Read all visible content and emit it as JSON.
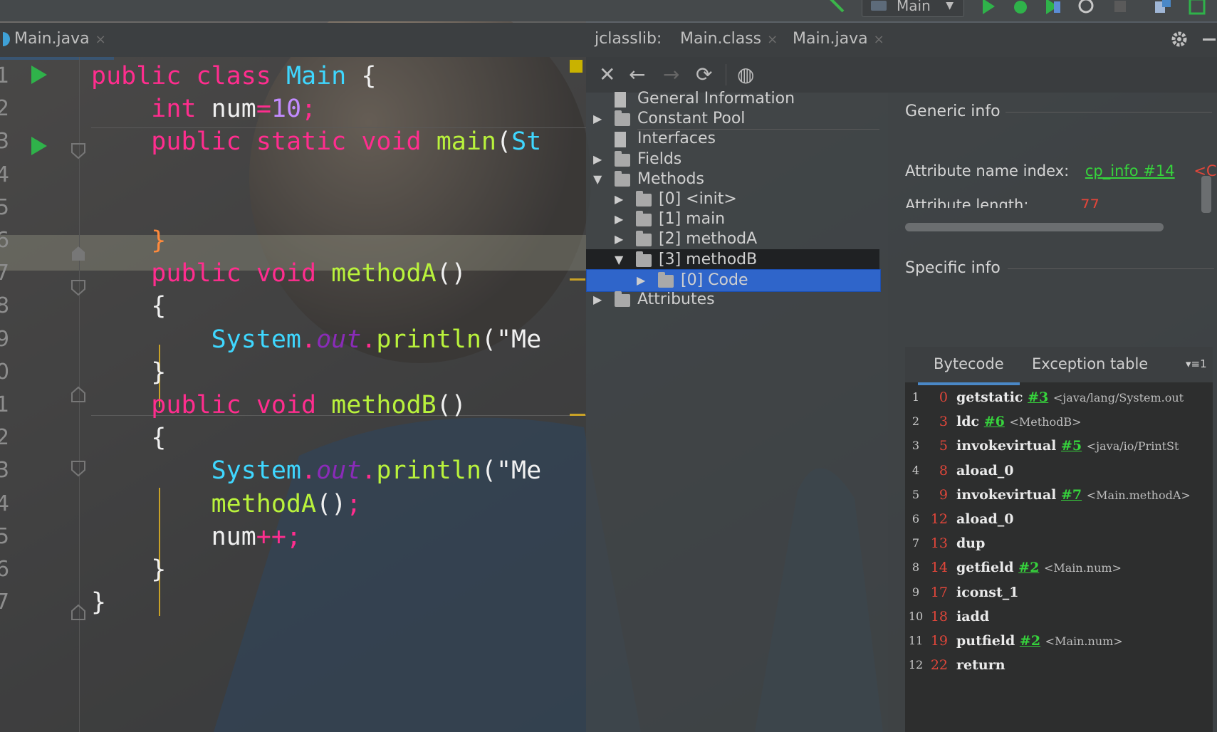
{
  "toolbar": {
    "run_config": "Main"
  },
  "editor": {
    "tab": {
      "label": "Main.java",
      "close": "×"
    },
    "lines": [
      {
        "n": "1",
        "tokens": [
          [
            "kw",
            "public "
          ],
          [
            "kw",
            "class "
          ],
          [
            "cls",
            "Main "
          ],
          [
            "plain",
            "{"
          ]
        ]
      },
      {
        "n": "2",
        "tokens": [
          [
            "plain",
            "    "
          ],
          [
            "kw",
            "int "
          ],
          [
            "plain",
            "num"
          ],
          [
            "kw",
            "="
          ],
          [
            "num",
            "10"
          ],
          [
            "kw",
            ";"
          ]
        ]
      },
      {
        "n": "3",
        "tokens": [
          [
            "plain",
            "    "
          ],
          [
            "kw",
            "public "
          ],
          [
            "kw",
            "static "
          ],
          [
            "kw",
            "void "
          ],
          [
            "fn",
            "main"
          ],
          [
            "plain",
            "("
          ],
          [
            "cls",
            "St"
          ]
        ]
      },
      {
        "n": "4",
        "tokens": []
      },
      {
        "n": "5",
        "tokens": []
      },
      {
        "n": "6",
        "tokens": [
          [
            "plain",
            "    "
          ],
          [
            "orange",
            "}"
          ]
        ]
      },
      {
        "n": "7",
        "tokens": [
          [
            "plain",
            "    "
          ],
          [
            "kw",
            "public "
          ],
          [
            "kw",
            "void "
          ],
          [
            "fn",
            "methodA"
          ],
          [
            "plain",
            "()"
          ]
        ]
      },
      {
        "n": "8",
        "tokens": [
          [
            "plain",
            "    {"
          ]
        ]
      },
      {
        "n": "9",
        "tokens": [
          [
            "plain",
            "        "
          ],
          [
            "cls",
            "System"
          ],
          [
            "kw",
            "."
          ],
          [
            "italic",
            "out"
          ],
          [
            "kw",
            "."
          ],
          [
            "fn",
            "println"
          ],
          [
            "plain",
            "(\"Me"
          ]
        ]
      },
      {
        "n": "0",
        "tokens": [
          [
            "plain",
            "    }"
          ]
        ]
      },
      {
        "n": "1",
        "tokens": [
          [
            "plain",
            "    "
          ],
          [
            "kw",
            "public "
          ],
          [
            "kw",
            "void "
          ],
          [
            "fn",
            "methodB"
          ],
          [
            "plain",
            "()"
          ]
        ]
      },
      {
        "n": "2",
        "tokens": [
          [
            "plain",
            "    {"
          ]
        ]
      },
      {
        "n": "3",
        "tokens": [
          [
            "plain",
            "        "
          ],
          [
            "cls",
            "System"
          ],
          [
            "kw",
            "."
          ],
          [
            "italic",
            "out"
          ],
          [
            "kw",
            "."
          ],
          [
            "fn",
            "println"
          ],
          [
            "plain",
            "(\"Me"
          ]
        ]
      },
      {
        "n": "4",
        "tokens": [
          [
            "plain",
            "        "
          ],
          [
            "fn",
            "methodA"
          ],
          [
            "plain",
            "()"
          ],
          [
            "kw",
            ";"
          ]
        ]
      },
      {
        "n": "5",
        "tokens": [
          [
            "plain",
            "        num"
          ],
          [
            "kw",
            "++;"
          ]
        ]
      },
      {
        "n": "6",
        "tokens": [
          [
            "plain",
            "    }"
          ]
        ]
      },
      {
        "n": "7",
        "tokens": [
          [
            "plain",
            "}"
          ]
        ]
      }
    ]
  },
  "right_tabs": {
    "tool_label": "jclasslib:",
    "tab1": {
      "label": "Main.class",
      "close": "×"
    },
    "tab2": {
      "label": "Main.java",
      "close": "×"
    }
  },
  "tree": {
    "items": [
      {
        "label": "General Information",
        "depth": 0,
        "arrow": "",
        "kind": "file"
      },
      {
        "label": "Constant Pool",
        "depth": 0,
        "arrow": "▶",
        "kind": "folder"
      },
      {
        "label": "Interfaces",
        "depth": 0,
        "arrow": "",
        "kind": "file"
      },
      {
        "label": "Fields",
        "depth": 0,
        "arrow": "▶",
        "kind": "folder"
      },
      {
        "label": "Methods",
        "depth": 0,
        "arrow": "▼",
        "kind": "folder"
      },
      {
        "label": "[0] <init>",
        "depth": 1,
        "arrow": "▶",
        "kind": "folder"
      },
      {
        "label": "[1] main",
        "depth": 1,
        "arrow": "▶",
        "kind": "folder"
      },
      {
        "label": "[2] methodA",
        "depth": 1,
        "arrow": "▶",
        "kind": "folder"
      },
      {
        "label": "[3] methodB",
        "depth": 1,
        "arrow": "▼",
        "kind": "folder",
        "state": "dark"
      },
      {
        "label": "[0] Code",
        "depth": 2,
        "arrow": "▶",
        "kind": "folder",
        "state": "selected"
      },
      {
        "label": "Attributes",
        "depth": 0,
        "arrow": "▶",
        "kind": "folder"
      }
    ]
  },
  "details": {
    "generic_title": "Generic info",
    "attr_name_label": "Attribute name index:",
    "attr_name_link": "cp_info #14",
    "attr_name_value": "<C",
    "attr_length_label": "Attribute length:",
    "attr_length_value": "77",
    "specific_title": "Specific info",
    "tabs": {
      "bytecode": "Bytecode",
      "exception": "Exception table",
      "menu": "▾≡1"
    },
    "bytecode": [
      {
        "n": "1",
        "off": "0",
        "op": "getstatic",
        "ref": "#3",
        "cmt": "<java/lang/System.out"
      },
      {
        "n": "2",
        "off": "3",
        "op": "ldc",
        "ref": "#6",
        "cmt": "<MethodB>"
      },
      {
        "n": "3",
        "off": "5",
        "op": "invokevirtual",
        "ref": "#5",
        "cmt": "<java/io/PrintSt"
      },
      {
        "n": "4",
        "off": "8",
        "op": "aload_0",
        "ref": "",
        "cmt": ""
      },
      {
        "n": "5",
        "off": "9",
        "op": "invokevirtual",
        "ref": "#7",
        "cmt": "<Main.methodA>"
      },
      {
        "n": "6",
        "off": "12",
        "op": "aload_0",
        "ref": "",
        "cmt": ""
      },
      {
        "n": "7",
        "off": "13",
        "op": "dup",
        "ref": "",
        "cmt": ""
      },
      {
        "n": "8",
        "off": "14",
        "op": "getfield",
        "ref": "#2",
        "cmt": "<Main.num>"
      },
      {
        "n": "9",
        "off": "17",
        "op": "iconst_1",
        "ref": "",
        "cmt": ""
      },
      {
        "n": "10",
        "off": "18",
        "op": "iadd",
        "ref": "",
        "cmt": ""
      },
      {
        "n": "11",
        "off": "19",
        "op": "putfield",
        "ref": "#2",
        "cmt": "<Main.num>"
      },
      {
        "n": "12",
        "off": "22",
        "op": "return",
        "ref": "",
        "cmt": ""
      }
    ]
  },
  "colors": {
    "accent": "#4a88c7",
    "selection": "#2f65ca",
    "link": "#36d33c",
    "keyword": "#ff2d8e"
  }
}
